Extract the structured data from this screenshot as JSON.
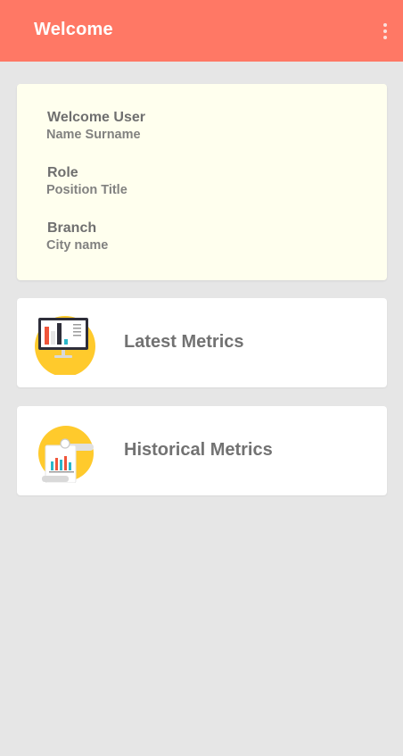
{
  "appbar": {
    "title": "Welcome",
    "menu_icon": "more-vert-icon",
    "color": "#ff7865"
  },
  "user_card": {
    "background": "#ffffee",
    "fields": [
      {
        "label": "Welcome User",
        "value": "Name Surname"
      },
      {
        "label": "Role",
        "value": "Position Title"
      },
      {
        "label": "Branch",
        "value": "City name"
      }
    ]
  },
  "menu": [
    {
      "label": "Latest Metrics",
      "icon": "monitor-chart-icon"
    },
    {
      "label": "Historical Metrics",
      "icon": "report-chart-icon"
    }
  ]
}
